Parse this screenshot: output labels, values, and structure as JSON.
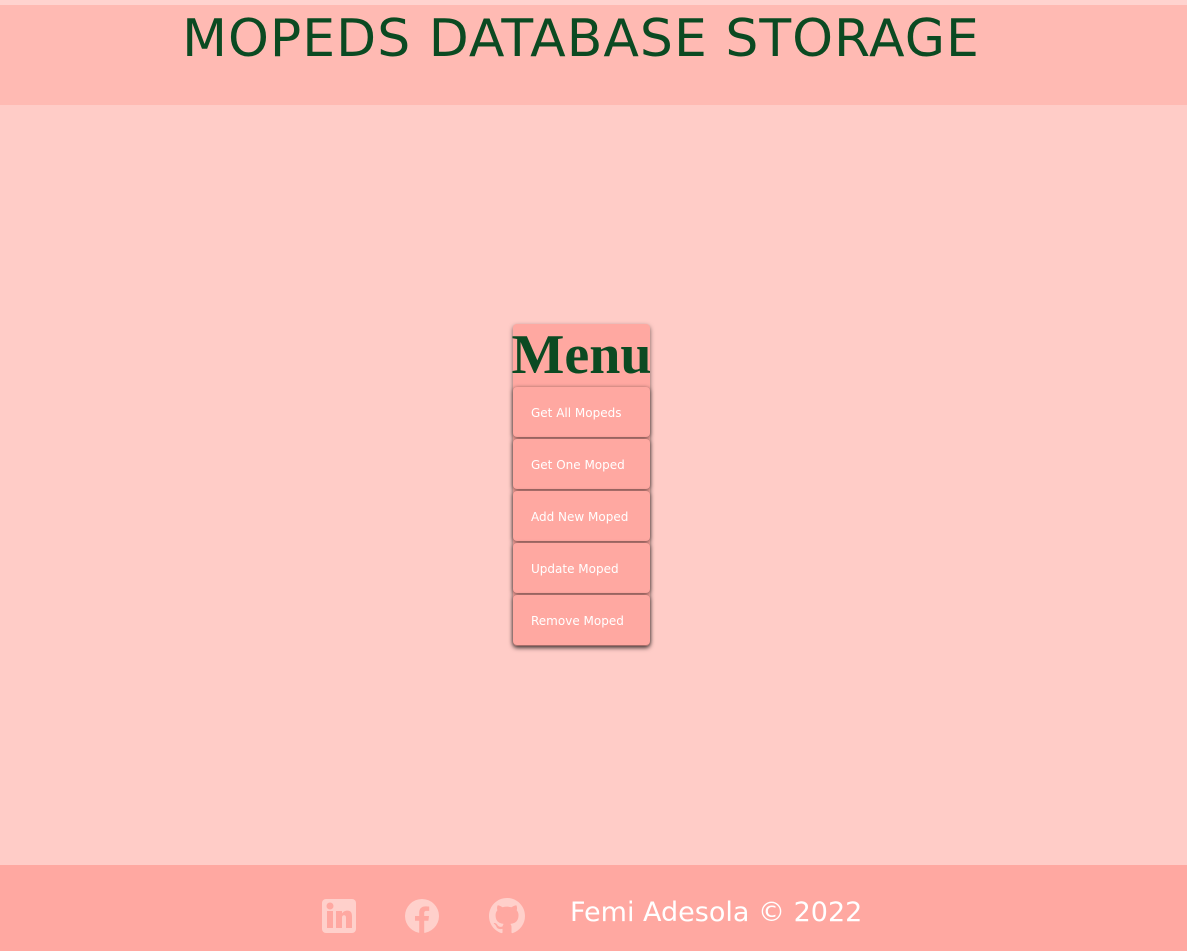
{
  "header": {
    "title": "MOPEDS DATABASE STORAGE"
  },
  "menu": {
    "title": "Menu",
    "items": [
      {
        "label": "Get All Mopeds"
      },
      {
        "label": "Get One Moped"
      },
      {
        "label": "Add New Moped"
      },
      {
        "label": "Update Moped"
      },
      {
        "label": "Remove Moped"
      }
    ]
  },
  "footer": {
    "social": [
      {
        "icon": "linkedin-icon"
      },
      {
        "icon": "facebook-icon"
      },
      {
        "icon": "github-icon"
      }
    ],
    "credit": "Femi Adesola © 2022"
  },
  "colors": {
    "header_bg": "#ffbab3",
    "page_bg": "#ffccc7",
    "menu_bg": "#ffa8a1",
    "footer_bg": "#ffa8a1",
    "title_green": "#0b4a22",
    "icon_pink": "#ffd0cb"
  }
}
